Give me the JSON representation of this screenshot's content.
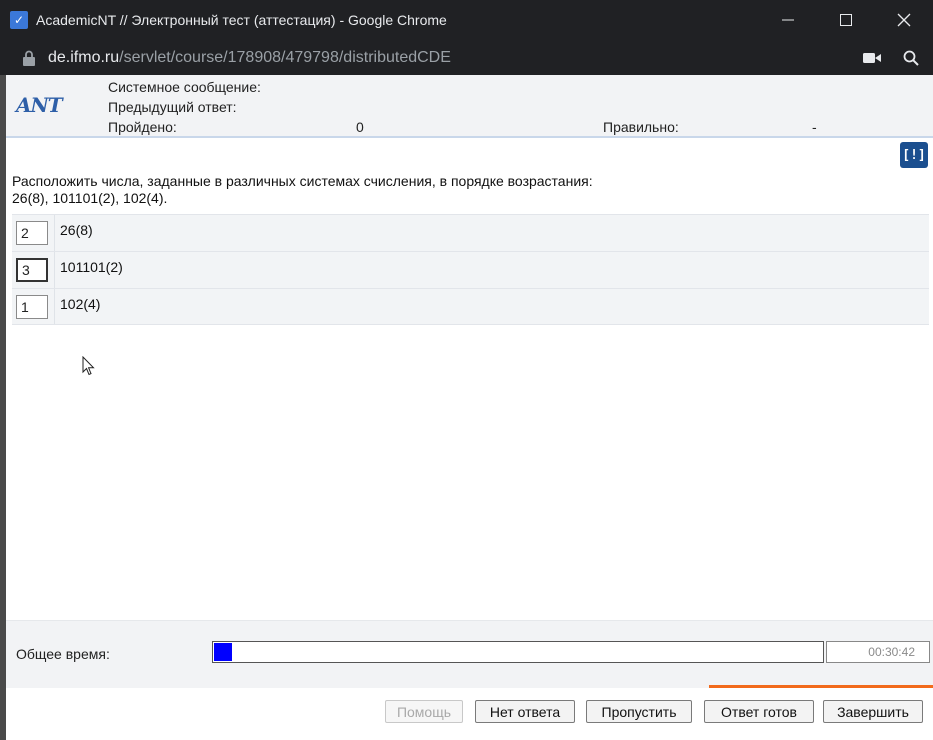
{
  "window": {
    "title": "AcademicNT // Электронный тест (аттестация) - Google Chrome",
    "app_icon": "academicnt-icon"
  },
  "address": {
    "host": "de.ifmo.ru",
    "path": "/servlet/course/178908/479798/distributedCDE"
  },
  "header": {
    "logo_text": "ANT",
    "system_message_label": "Системное сообщение:",
    "previous_answer_label": "Предыдущий ответ:",
    "passed_label": "Пройдено:",
    "passed_value": "0",
    "correct_label": "Правильно:",
    "correct_value": "-"
  },
  "help_badge": "[!]",
  "question": {
    "line1": "Расположить числа, заданные в различных системах счисления, в порядке возрастания:",
    "line2": "26(8), 101101(2), 102(4)."
  },
  "answers": [
    {
      "order": "2",
      "text": "26(8)"
    },
    {
      "order": "3",
      "text": "101101(2)"
    },
    {
      "order": "1",
      "text": "102(4)"
    }
  ],
  "timer": {
    "label": "Общее время:",
    "value": "00:30:42",
    "progress_fraction": 0.03
  },
  "buttons": {
    "help": "Помощь",
    "no_answer": "Нет ответа",
    "skip": "Пропустить",
    "answer_ready": "Ответ готов",
    "finish": "Завершить"
  },
  "colors": {
    "progress_fill": "#0000ff",
    "accent_line": "#f26a1b",
    "badge": "#1b4f8f"
  }
}
